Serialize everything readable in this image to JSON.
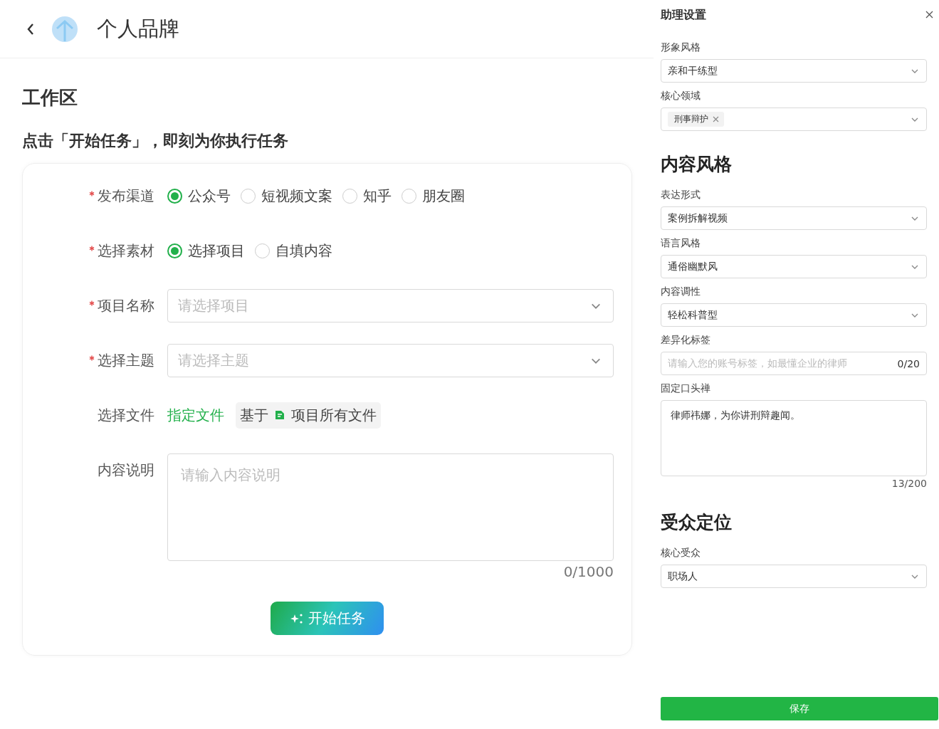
{
  "header": {
    "title": "个人品牌"
  },
  "workspace": {
    "title": "工作区",
    "instruction": "点击「开始任务」，即刻为你执行任务",
    "form": [
      {
        "kind": "radio",
        "label": "发布渠道",
        "required": true,
        "options": [
          {
            "label": "公众号",
            "selected": true
          },
          {
            "label": "短视频文案",
            "selected": false
          },
          {
            "label": "知乎",
            "selected": false
          },
          {
            "label": "朋友圈",
            "selected": false
          }
        ]
      },
      {
        "kind": "radio",
        "label": "选择素材",
        "required": true,
        "options": [
          {
            "label": "选择项目",
            "selected": true
          },
          {
            "label": "自填内容",
            "selected": false
          }
        ]
      },
      {
        "kind": "select",
        "label": "项目名称",
        "required": true,
        "placeholder": "请选择项目"
      },
      {
        "kind": "select",
        "label": "选择主题",
        "required": true,
        "placeholder": "请选择主题"
      },
      {
        "kind": "files",
        "label": "选择文件",
        "required": false,
        "link": "指定文件",
        "prefix": "基于",
        "scope": "项目所有文件"
      },
      {
        "kind": "textarea",
        "label": "内容说明",
        "required": false,
        "placeholder": "请输入内容说明",
        "counter": "0/1000"
      }
    ],
    "start_button": "开始任务"
  },
  "panel": {
    "title": "助理设置",
    "sections": [
      {
        "fields": [
          {
            "kind": "select",
            "label": "形象风格",
            "value": "亲和干练型"
          },
          {
            "kind": "tags",
            "label": "核心领域",
            "tags": [
              "刑事辩护"
            ]
          }
        ]
      },
      {
        "heading": "内容风格",
        "fields": [
          {
            "kind": "select",
            "label": "表达形式",
            "value": "案例拆解视频"
          },
          {
            "kind": "select",
            "label": "语言风格",
            "value": "通俗幽默风"
          },
          {
            "kind": "select",
            "label": "内容调性",
            "value": "轻松科普型"
          },
          {
            "kind": "input",
            "label": "差异化标签",
            "placeholder": "请输入您的账号标签，如最懂企业的律师",
            "counter": "0/20"
          },
          {
            "kind": "textarea",
            "label": "固定口头禅",
            "value": "律师祎娜，为你讲刑辩趣闻。",
            "counter": "13/200"
          }
        ]
      },
      {
        "heading": "受众定位",
        "fields": [
          {
            "kind": "select",
            "label": "核心受众",
            "value": "职场人"
          }
        ]
      }
    ],
    "save_button": "保存"
  }
}
